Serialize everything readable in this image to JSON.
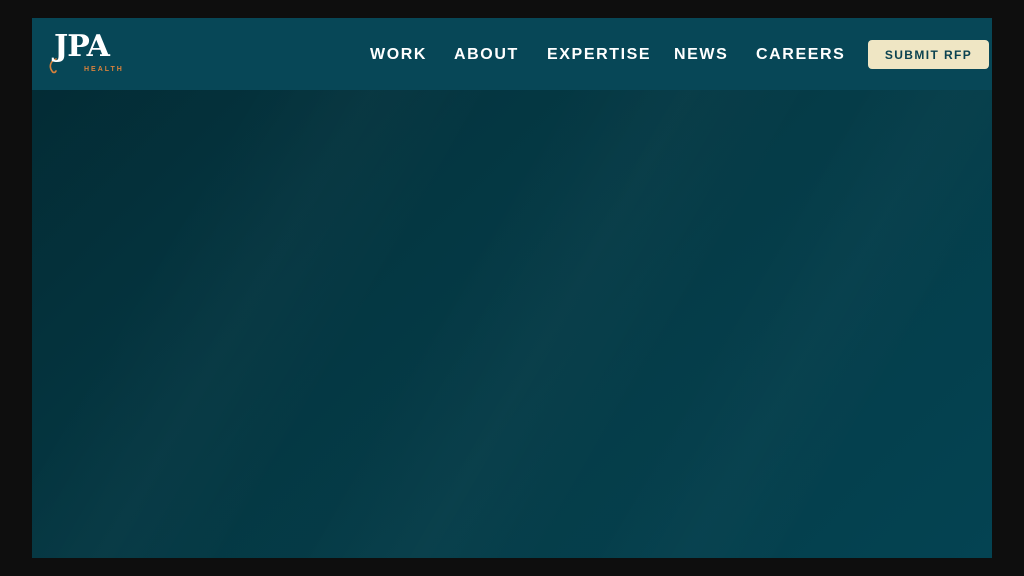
{
  "brand": {
    "logo_text": "JPA",
    "logo_subtext": "HEALTH",
    "logo_accent_color": "#d9823c"
  },
  "nav": {
    "items": [
      {
        "label": "WORK"
      },
      {
        "label": "ABOUT"
      },
      {
        "label": "EXPERTISE"
      },
      {
        "label": "NEWS"
      },
      {
        "label": "CAREERS"
      }
    ],
    "cta_label": "SUBMIT RFP",
    "cta_color": "#efe6c4",
    "bar_color": "#074757"
  },
  "hero": {
    "background_color": "#043641"
  }
}
